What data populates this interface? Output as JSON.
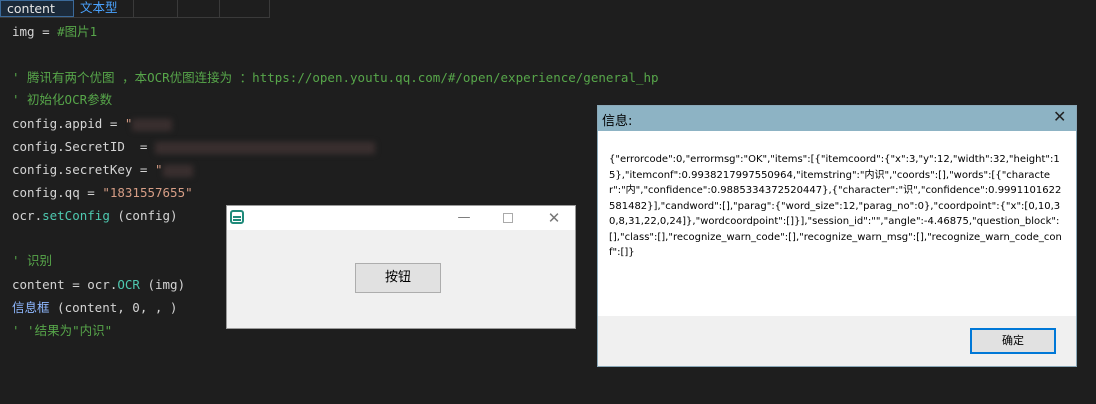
{
  "table_header": {
    "col1": "content",
    "col2": "文本型",
    "col3": "",
    "col4": "",
    "col5": ""
  },
  "code": {
    "line1_var": "img",
    "line1_op": " = ",
    "line1_comment": "#图片1",
    "line2_comment": "' 腾讯有两个优图 ，本OCR优图连接为 ：https://open.youtu.qq.com/#/open/experience/general_hp",
    "line3_comment": "' 初始化OCR参数",
    "line4": "config.appid = ",
    "line4_quote": "\"",
    "line5": "config.SecretID  = ",
    "line6": "config.secretKey = ",
    "line6_quote": "\"",
    "line7": "config.qq = ",
    "line7_value": "\"1831557655\"",
    "line8_a": "ocr.",
    "line8_fn": "setConfig",
    "line8_b": " (config)",
    "line9_comment": "' 识别",
    "line10_a": "content = ocr.",
    "line10_fn": "OCR",
    "line10_b": " (img)",
    "line11_a": "信息框",
    "line11_b": " (content, 0, , )",
    "line12_comment": "' '结果为\"内识\""
  },
  "small_window": {
    "button_label": "按钮",
    "min_symbol": "—",
    "close_symbol": "✕"
  },
  "msg_window": {
    "title": "信息:",
    "close_symbol": "✕",
    "message": "{\"errorcode\":0,\"errormsg\":\"OK\",\"items\":[{\"itemcoord\":{\"x\":3,\"y\":12,\"width\":32,\"height\":15},\"itemconf\":0.9938217997550964,\"itemstring\":\"内识\",\"coords\":[],\"words\":[{\"character\":\"内\",\"confidence\":0.9885334372520447},{\"character\":\"识\",\"confidence\":0.9991101622581482}],\"candword\":[],\"parag\":{\"word_size\":12,\"parag_no\":0},\"coordpoint\":{\"x\":[0,10,30,8,31,22,0,24]},\"wordcoordpoint\":[]}],\"session_id\":\"\",\"angle\":-4.46875,\"question_block\":[],\"class\":[],\"recognize_warn_code\":[],\"recognize_warn_msg\":[],\"recognize_warn_code_conf\":[]}",
    "ok_label": "确定"
  }
}
